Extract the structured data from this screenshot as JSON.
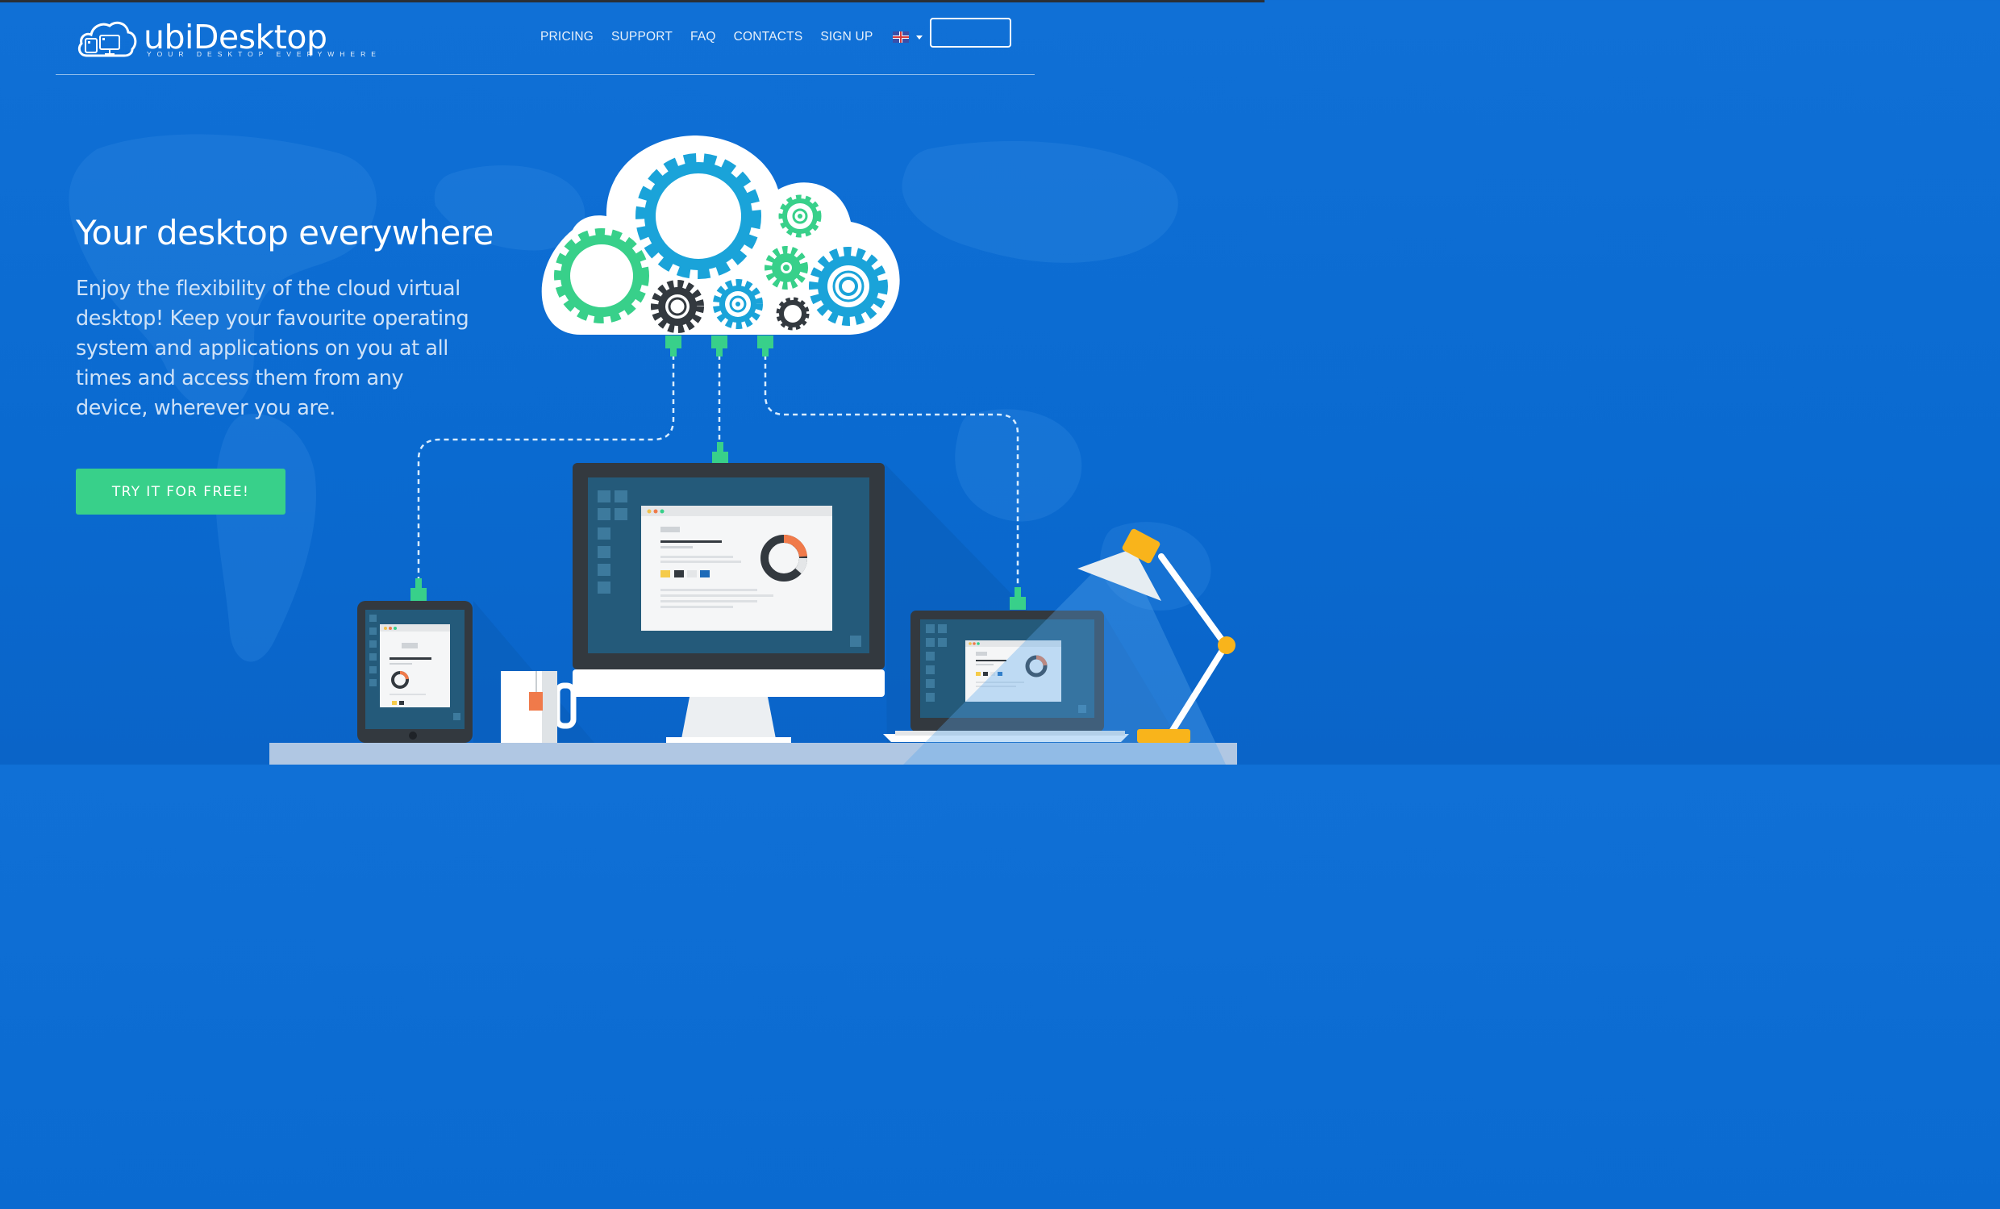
{
  "brand": {
    "name": "ubiDesktop",
    "tagline": "YOUR DESKTOP EVERYWHERE"
  },
  "nav": {
    "items": [
      "PRICING",
      "SUPPORT",
      "FAQ",
      "CONTACTS",
      "SIGN UP"
    ],
    "language_icon": "uk-flag-icon"
  },
  "hero": {
    "title": "Your desktop everywhere",
    "text": "Enjoy the flexibility of the cloud virtual desktop! Keep your favourite operating system and applications on you at all times and access them from any device, wherever you are.",
    "cta": "TRY IT FOR FREE!"
  },
  "colors": {
    "background": "#0a6ad0",
    "accent_green": "#38d08a",
    "gear_blue": "#1aa3d9",
    "dark": "#33393f"
  }
}
